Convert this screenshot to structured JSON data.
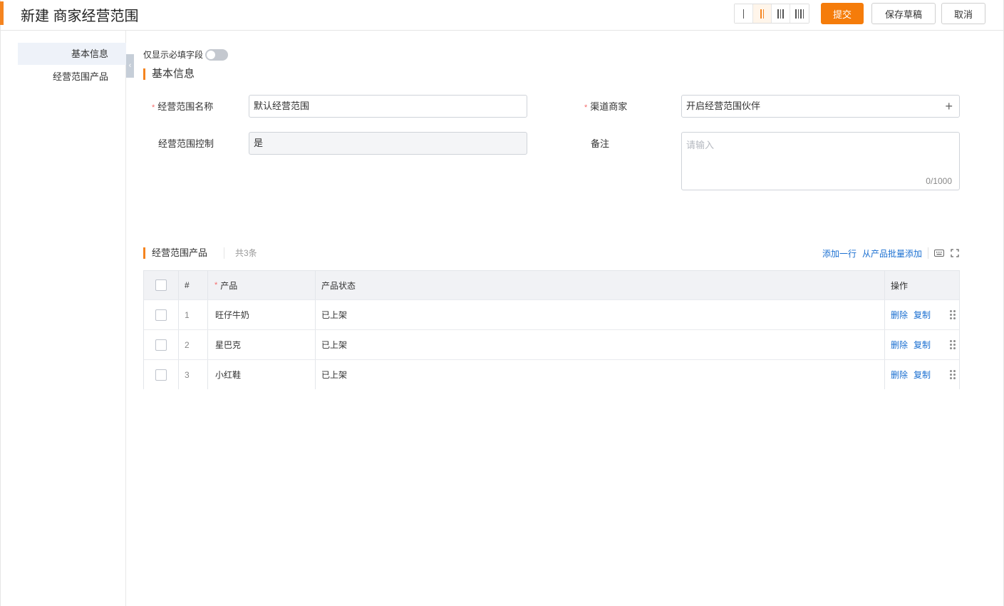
{
  "header": {
    "title": "新建 商家经营范围",
    "submit_label": "提交",
    "save_draft_label": "保存草稿",
    "cancel_label": "取消",
    "accent_color": "#f5841f"
  },
  "layout_options": [
    {
      "icon": "one-column-icon",
      "active": false
    },
    {
      "icon": "two-column-icon",
      "active": true
    },
    {
      "icon": "three-column-icon",
      "active": false
    },
    {
      "icon": "four-column-icon",
      "active": false
    }
  ],
  "sidebar": {
    "items": [
      {
        "label": "基本信息",
        "active": true
      },
      {
        "label": "经营范围产品",
        "active": false
      }
    ]
  },
  "form": {
    "required_only_label": "仅显示必填字段",
    "required_only_on": false,
    "section_title": "基本信息",
    "scope_name": {
      "label": "经营范围名称",
      "value": "默认经营范围",
      "required": true
    },
    "channel_merchant": {
      "label": "渠道商家",
      "value": "开启经营范围伙伴",
      "required": true
    },
    "scope_control": {
      "label": "经营范围控制",
      "value": "是",
      "disabled": true
    },
    "remark": {
      "label": "备注",
      "placeholder": "请输入",
      "counter": "0/1000"
    }
  },
  "products": {
    "section_title": "经营范围产品",
    "count_text": "共3条",
    "add_row_label": "添加一行",
    "batch_add_label": "从产品批量添加",
    "columns": {
      "index": "#",
      "product": "产品",
      "status": "产品状态",
      "actions": "操作"
    },
    "rows": [
      {
        "index": "1",
        "product": "旺仔牛奶",
        "status": "已上架"
      },
      {
        "index": "2",
        "product": "星巴克",
        "status": "已上架"
      },
      {
        "index": "3",
        "product": "小红鞋",
        "status": "已上架"
      }
    ],
    "delete_label": "删除",
    "copy_label": "复制"
  }
}
